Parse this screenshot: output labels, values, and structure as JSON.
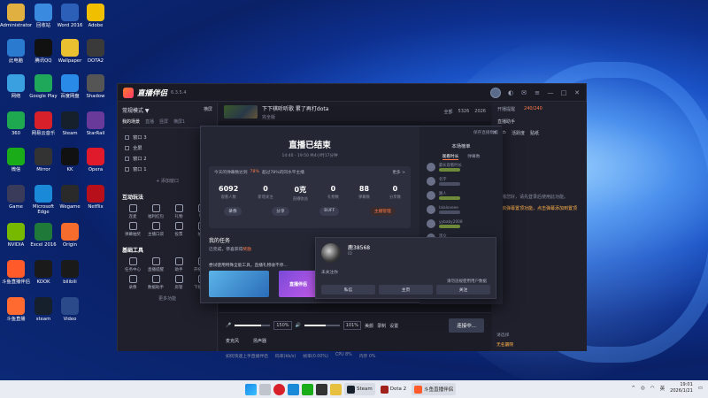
{
  "desktop": {
    "icons": [
      {
        "label": "Administrator",
        "color": "#e0b040"
      },
      {
        "label": "回收站",
        "color": "#3a8ae0"
      },
      {
        "label": "Word 2016",
        "color": "#2b5fb8"
      },
      {
        "label": "Adobe",
        "color": "#f0c000"
      },
      {
        "label": "此电脑",
        "color": "#2a7ad0"
      },
      {
        "label": "腾讯QQ",
        "color": "#111111"
      },
      {
        "label": "Wallpaper",
        "color": "#e8c030"
      },
      {
        "label": "DOTA2",
        "color": "#3a3a3a"
      },
      {
        "label": "网络",
        "color": "#3aa0e0"
      },
      {
        "label": "Google Play",
        "color": "#1fa85a"
      },
      {
        "label": "百度网盘",
        "color": "#2a8ae8"
      },
      {
        "label": "Shadow",
        "color": "#555555"
      },
      {
        "label": "360",
        "color": "#1ea850"
      },
      {
        "label": "网易云音乐",
        "color": "#d8202a"
      },
      {
        "label": "Steam",
        "color": "#16202d"
      },
      {
        "label": "StarRail",
        "color": "#6a3a9a"
      },
      {
        "label": "微信",
        "color": "#1aad19"
      },
      {
        "label": "Mirror",
        "color": "#333333"
      },
      {
        "label": "KK",
        "color": "#111111"
      },
      {
        "label": "Opera",
        "color": "#e01a2a"
      },
      {
        "label": "Game",
        "color": "#3a3a5a"
      },
      {
        "label": "Microsoft Edge",
        "color": "#1a8ad8"
      },
      {
        "label": "Wegame",
        "color": "#2a2a2a"
      },
      {
        "label": "Netflix",
        "color": "#b8101a"
      },
      {
        "label": "NVIDIA",
        "color": "#76b900"
      },
      {
        "label": "Excel 2016",
        "color": "#1f7a3a"
      },
      {
        "label": "Origin",
        "color": "#f56c2d"
      },
      {
        "label": "斗鱼直播伴侣",
        "color": "#ff5a2a"
      },
      {
        "label": "KOOK",
        "color": "#1a1a1a"
      },
      {
        "label": "bilibili",
        "color": "#1a1a1a"
      },
      {
        "label": "斗鱼直播",
        "color": "#ff6a30"
      },
      {
        "label": "steam",
        "color": "#16202d"
      },
      {
        "label": "Video",
        "color": "#2a4a8a"
      }
    ]
  },
  "app": {
    "title": "直播伴侣",
    "version": "6.3.5.4",
    "left": {
      "mode_label": "常规模式 ▼",
      "switch_label": "横屏",
      "tabs": [
        "我的场景",
        "直播",
        "竖屏",
        "横屏1"
      ],
      "scenes": [
        "窗口 3",
        "全屏",
        "窗口 2",
        "窗口 1"
      ],
      "add_scene": "+ 添加窗口",
      "interactive_title": "互动玩法",
      "interactive_items": [
        "连麦",
        "福利红包",
        "礼物",
        "PK",
        "弹幕抽奖",
        "主播口袋",
        "投票",
        "抽奖"
      ],
      "tools_title": "基础工具",
      "tools_items": [
        "任务中心",
        "直播提醒",
        "助手",
        "开播工具",
        "录像",
        "数据助手",
        "房管",
        "下播助手"
      ],
      "more": "更多功能"
    },
    "center": {
      "stream_title": "下下棋听听歌 累了再打dota",
      "category": "完全版",
      "stat1": "全部",
      "stat2": "5326",
      "stat3": "2026",
      "mic_label": "麦克风",
      "speaker_label": "扬声器",
      "mic_value": "150%",
      "speaker_value": "101%",
      "tools": [
        "美颜",
        "录制",
        "设置"
      ],
      "start_btn": "连接中...",
      "status": [
        "如何快速上手直播伴侣",
        "码率(kb/s)",
        "帧率(0.00%)",
        "CPU 8%",
        "内存 0%"
      ]
    },
    "right": {
      "tabs": [
        "开播提醒",
        "活动",
        "贴图"
      ],
      "title": "直播助手",
      "counter": "240/240",
      "top": [
        "用户",
        "活跃度",
        "贴纸"
      ],
      "warn": "开启弹幕置顶功能，点击弹幕添加到置顶",
      "hint": "主播您好，请先登录后使用此功能。",
      "send_hint": "请选择",
      "user_name": "无名霸院"
    }
  },
  "dialog": {
    "title": "直播已结束",
    "time": "14:40 - 19:50  共4小时17分钟",
    "notice": "今天的弹幕数达到",
    "notice_hi": "78%",
    "notice_tail": "超过78%的同水平主播",
    "more": "更多 >",
    "numbers": [
      {
        "value": "6092",
        "label": "观看人数"
      },
      {
        "value": "0",
        "label": "新增关注"
      },
      {
        "value": "0克",
        "label": "直播收益"
      },
      {
        "value": "0",
        "label": "礼物数"
      },
      {
        "value": "88",
        "label": "弹幕数"
      },
      {
        "value": "0",
        "label": "分享数"
      }
    ],
    "actions": [
      "录像",
      "分享",
      "BUFF",
      "主播管理"
    ],
    "task_title": "我的任务",
    "task_sub": "已完成，恭喜获得",
    "task_hi": "奖励",
    "promo": "尝试使用特殊全能工具，直播礼物收不停...",
    "banner2": "直播伴侣",
    "top_right": "保存直播数据",
    "viewers_title": "本场榜单",
    "viewer_tabs": [
      "观看时长",
      "弹幕数"
    ],
    "viewers": [
      "最长观看时长",
      "名字",
      "路人",
      "lalaloveee",
      "yybaby2008",
      "观众",
      "水蜜桃",
      "Kuku",
      "斗鱼用户"
    ]
  },
  "popup": {
    "name": "鹿38568",
    "id": "ID",
    "status": "未关注你",
    "check": "请勿违规使用用户数据",
    "buttons": [
      "私信",
      "主页",
      "关注"
    ]
  },
  "taskbar": {
    "apps": [
      "Steam",
      "Dota 2",
      "斗鱼直播伴侣"
    ],
    "lang": "英",
    "time": "19:01",
    "date": "2026/1/21"
  }
}
